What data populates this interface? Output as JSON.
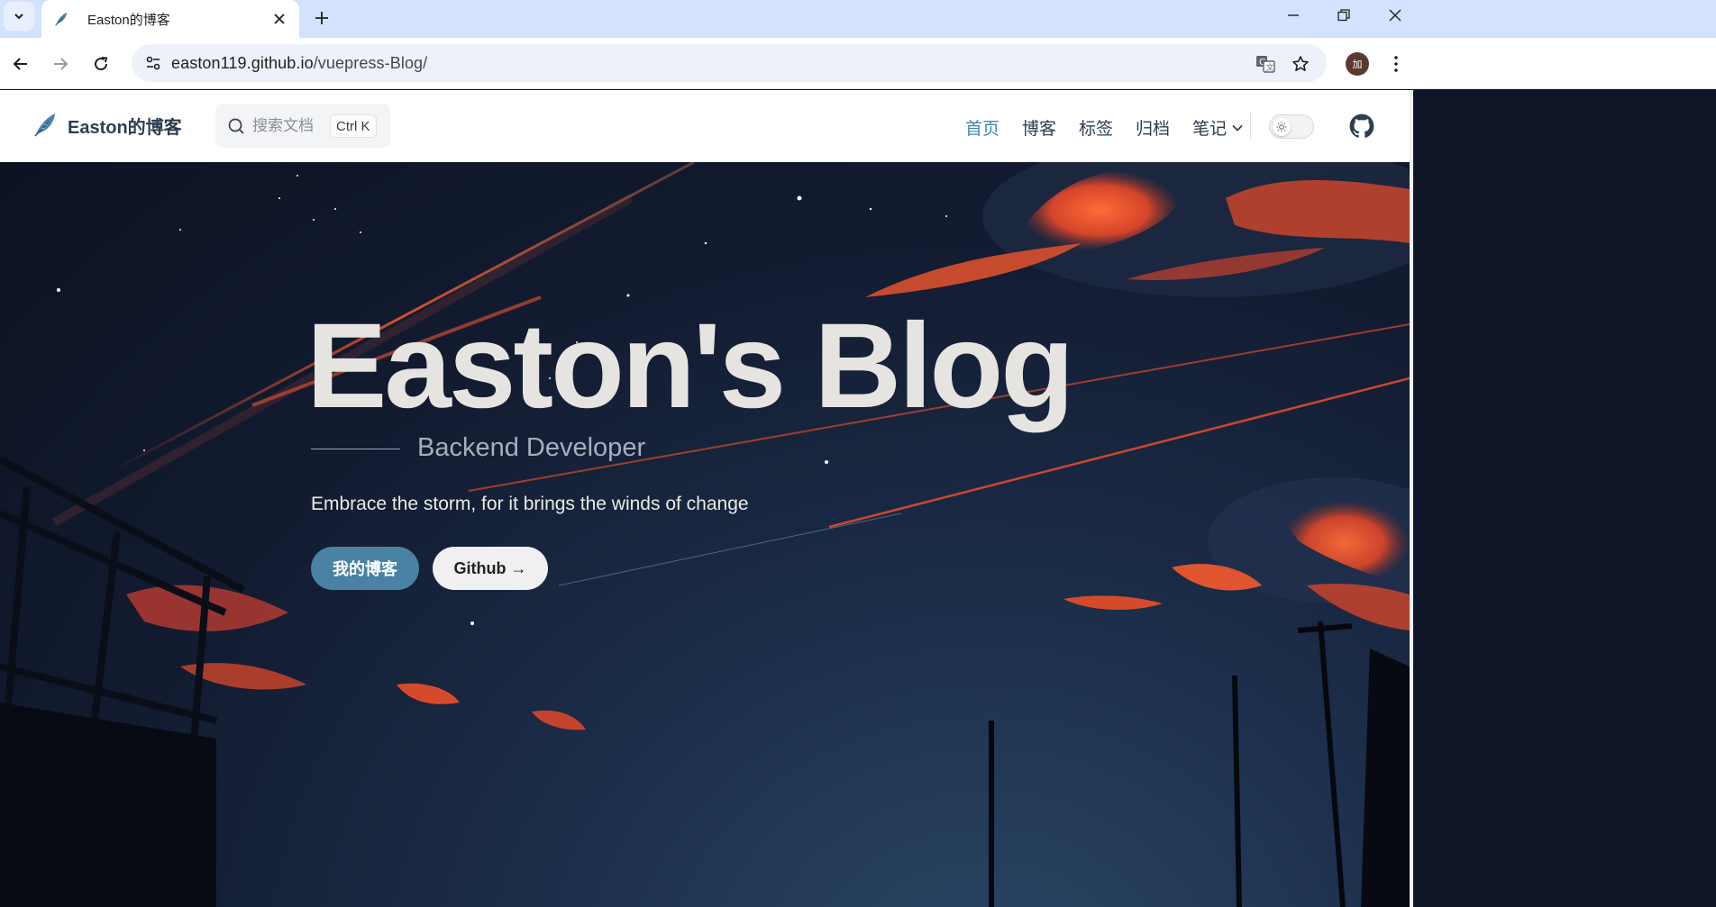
{
  "browser": {
    "tab_title": "Easton的博客",
    "url_host": "easton119.github.io",
    "url_path": "/vuepress-Blog/",
    "profile_initial": "加"
  },
  "site": {
    "brand_name": "Easton的博客",
    "search_placeholder": "搜索文档",
    "search_shortcut": "Ctrl K",
    "nav": [
      {
        "label": "首页",
        "active": true
      },
      {
        "label": "博客"
      },
      {
        "label": "标签"
      },
      {
        "label": "归档"
      },
      {
        "label": "笔记",
        "dropdown": true
      }
    ],
    "theme": "light"
  },
  "hero": {
    "title": "Easton's Blog",
    "tagline": "Backend Developer",
    "description": "Embrace the storm, for it brings the winds of change",
    "primary_button": "我的博客",
    "secondary_button": "Github →"
  },
  "colors": {
    "accent": "#3f86b3",
    "primary_button": "#4a82a3",
    "hero_bg": "#121b30",
    "cloud_orange": "#e8532d"
  },
  "icons": [
    "tab-search-icon",
    "feather-logo-icon",
    "close-icon",
    "plus-icon",
    "minimize-icon",
    "restore-icon",
    "window-close-icon",
    "back-icon",
    "forward-icon",
    "reload-icon",
    "site-info-icon",
    "translate-icon",
    "star-icon",
    "kebab-menu-icon",
    "search-icon",
    "chevron-down-icon",
    "sun-icon",
    "github-icon"
  ]
}
